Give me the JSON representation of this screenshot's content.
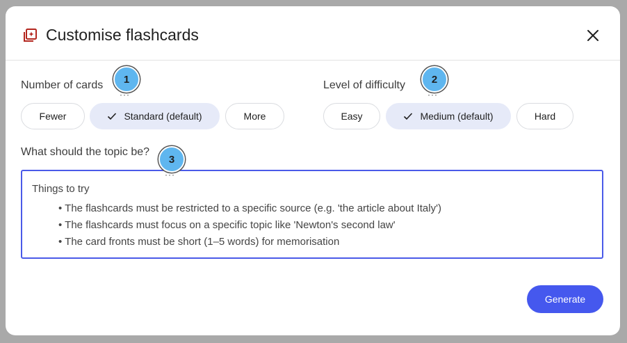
{
  "dialog": {
    "title": "Customise flashcards",
    "icons": {
      "header": "flashcards-icon",
      "close": "close-icon"
    }
  },
  "number_of_cards": {
    "label": "Number of cards",
    "options": [
      "Fewer",
      "Standard (default)",
      "More"
    ],
    "selected": "Standard (default)"
  },
  "difficulty": {
    "label": "Level of difficulty",
    "options": [
      "Easy",
      "Medium (default)",
      "Hard"
    ],
    "selected": "Medium (default)"
  },
  "topic": {
    "label": "What should the topic be?",
    "placeholder_heading": "Things to try",
    "tips": [
      "The flashcards must be restricted to a specific source (e.g. 'the article about Italy')",
      "The flashcards must focus on a specific topic like 'Newton's second law'",
      "The card fronts must be short (1–5 words) for memorisation"
    ]
  },
  "markers": [
    "1",
    "2",
    "3"
  ],
  "actions": {
    "generate": "Generate"
  },
  "colors": {
    "accent": "#4558ee",
    "selected_chip": "#e6eaf8",
    "marker": "#5fb6ef",
    "icon": "#b3261e"
  }
}
